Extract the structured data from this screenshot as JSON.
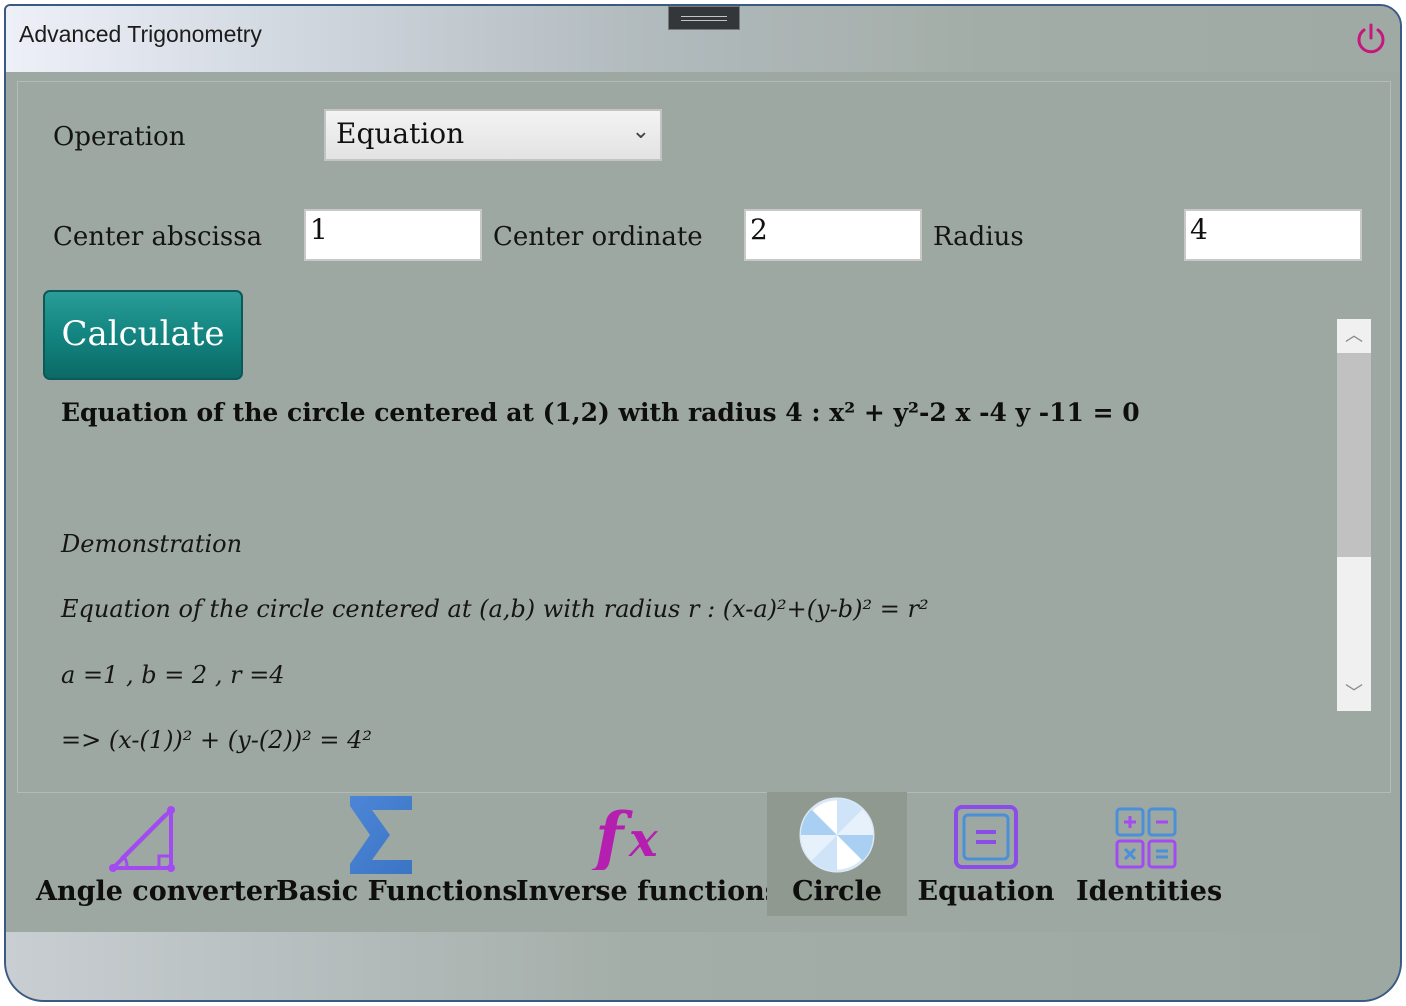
{
  "window": {
    "title": "Advanced Trigonometry"
  },
  "form": {
    "operation_label": "Operation",
    "operation_value": "Equation",
    "center_abscissa_label": "Center abscissa",
    "center_abscissa_value": "1",
    "center_ordinate_label": "Center ordinate",
    "center_ordinate_value": "2",
    "radius_label": "Radius",
    "radius_value": "4",
    "calculate_label": "Calculate"
  },
  "result": {
    "main": "Equation of the circle centered at (1,2) with radius  4 :  x² + y²-2 x -4 y -11 = 0",
    "demonstration_heading": "Demonstration",
    "general_formula": "Equation of the circle centered at (a,b) with radius  r : (x-a)²+(y-b)² = r²",
    "values": " a =1 , b = 2 , r =4",
    "substitution": "=> (x-(1))² + (y-(2))² = 4²"
  },
  "nav": {
    "items": [
      {
        "label": "Angle converter",
        "icon": "angle-icon",
        "selected": false
      },
      {
        "label": "Basic Functions",
        "icon": "sigma-icon",
        "selected": false
      },
      {
        "label": "Inverse functions",
        "icon": "fx-icon",
        "selected": false
      },
      {
        "label": "Circle",
        "icon": "circle-icon",
        "selected": true
      },
      {
        "label": "Equation",
        "icon": "equation-icon",
        "selected": false
      },
      {
        "label": "Identities",
        "icon": "calculator-icon",
        "selected": false
      }
    ]
  },
  "colors": {
    "background": "#9ea8a2",
    "accent_teal": "#148783",
    "power_magenta": "#c4187c",
    "icon_purple": "#a24bf0",
    "icon_blue": "#4b8fd8"
  }
}
